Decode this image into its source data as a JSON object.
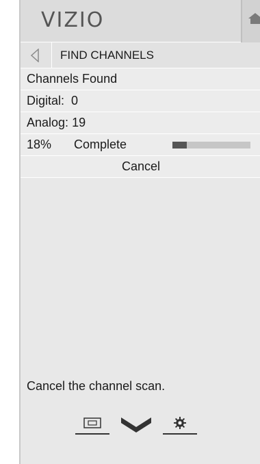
{
  "header": {
    "logo_text": "VIZIO",
    "home_icon": "home-icon"
  },
  "menu": {
    "title": "FIND CHANNELS",
    "back_icon": "back-triangle-icon",
    "channels_found_label": "Channels Found",
    "digital_label": "Digital:",
    "digital_value": "0",
    "analog_label": "Analog:",
    "analog_value": "19",
    "progress_percent_text": "18%",
    "progress_value": 18,
    "complete_label": "Complete",
    "cancel_label": "Cancel"
  },
  "help_text": "Cancel the channel scan.",
  "bottom_icons": [
    "picture-in-picture-icon",
    "vizio-v-icon",
    "gear-icon"
  ],
  "colors": {
    "panel": "#e8e8e8",
    "progress_fill": "#555555",
    "progress_track": "#c6c6c6"
  }
}
